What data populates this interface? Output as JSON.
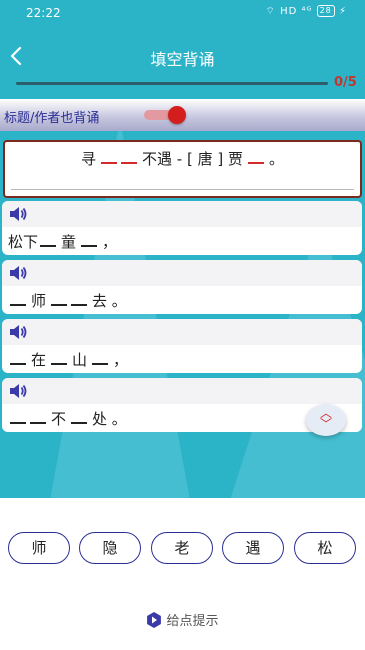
{
  "status_bar": {
    "time": "22:22",
    "icons": "⌔ HD ⁴ᴳ",
    "battery": "28",
    "charging": "⚡"
  },
  "header": {
    "back_icon": "back-chevron",
    "title": "填空背诵"
  },
  "progress": {
    "text": "0/5",
    "fraction": 0.0
  },
  "options": {
    "label": "标题/作者也背诵",
    "toggle_on": true
  },
  "poem_title": {
    "parts": [
      "寻",
      "不遇 - [ 唐 ] 贾",
      "。"
    ]
  },
  "lines": [
    {
      "speaker_icon": "speaker-icon",
      "parts": [
        "松下",
        "童",
        "，"
      ]
    },
    {
      "speaker_icon": "speaker-icon",
      "parts": [
        "师",
        "去 。"
      ]
    },
    {
      "speaker_icon": "speaker-icon",
      "parts": [
        "在",
        "山",
        "，"
      ]
    },
    {
      "speaker_icon": "speaker-icon",
      "parts": [
        "不",
        "处 。"
      ]
    }
  ],
  "choices": [
    "师",
    "隐",
    "老",
    "遇",
    "松"
  ],
  "hint": {
    "label": "给点提示",
    "icon": "hint-icon"
  },
  "colors": {
    "background": "#2bb3c8",
    "accent_red": "#d42a2a",
    "button_border": "#2a2f93",
    "title_border": "#7a2b1e"
  }
}
